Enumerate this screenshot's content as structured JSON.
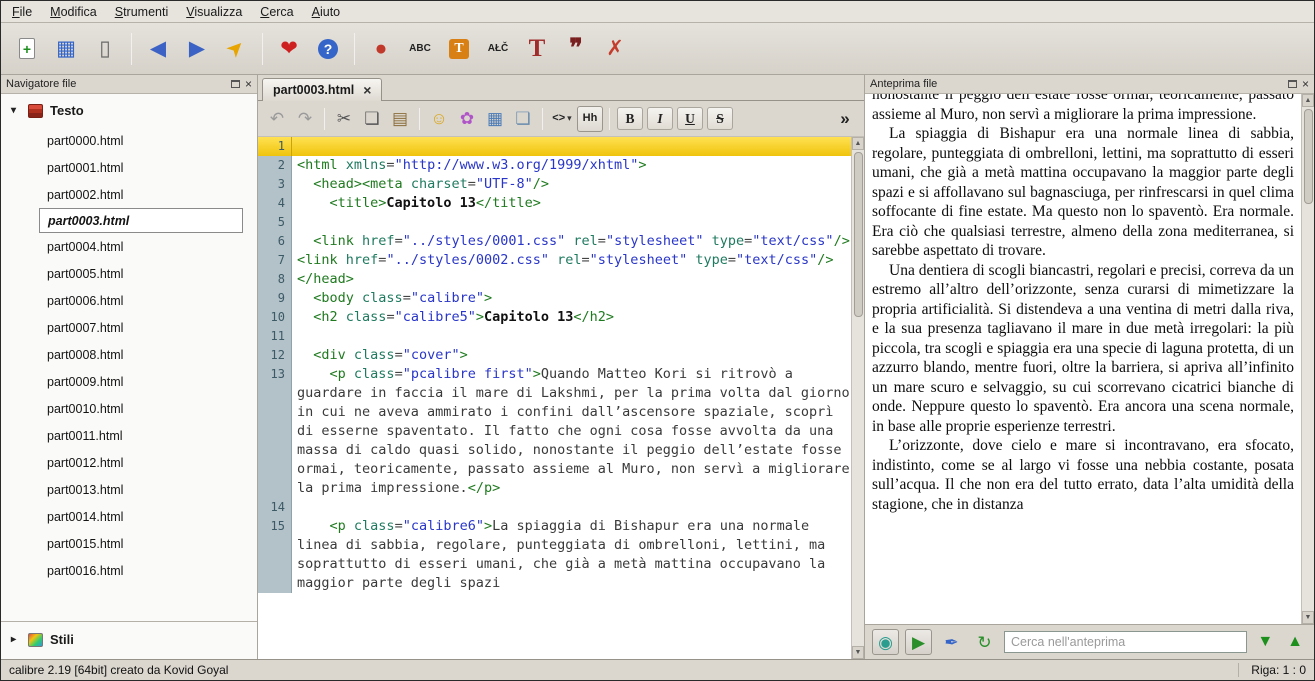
{
  "window": {
    "status_left": "calibre 2.19 [64bit] creato da Kovid Goyal",
    "status_right": "Riga: 1 : 0"
  },
  "menu": {
    "items": [
      "File",
      "Modifica",
      "Strumenti",
      "Visualizza",
      "Cerca",
      "Aiuto"
    ]
  },
  "main_toolbar": [
    {
      "name": "new-file-icon",
      "glyph": "+",
      "color": "#1e8f1e",
      "cls": "doc"
    },
    {
      "name": "save-icon",
      "glyph": "▦",
      "color": "#3565c8"
    },
    {
      "name": "send-to-device-icon",
      "glyph": "▯",
      "color": "#6a6a6a"
    },
    {
      "sep": true
    },
    {
      "name": "back-icon",
      "glyph": "◀",
      "color": "#3b62c4"
    },
    {
      "name": "forward-icon",
      "glyph": "▶",
      "color": "#3b62c4"
    },
    {
      "name": "goto-location-icon",
      "glyph": "➤",
      "color": "#e8a400",
      "cls": "rot-ne"
    },
    {
      "sep": true
    },
    {
      "name": "donate-icon",
      "glyph": "❤",
      "color": "#cf2020"
    },
    {
      "name": "help-icon",
      "glyph": "?",
      "color": "#ffffff",
      "cls": "circle-blue"
    },
    {
      "sep": true
    },
    {
      "name": "check-book-icon",
      "glyph": "●",
      "color": "#c0392b"
    },
    {
      "name": "spell-check-icon",
      "glyph": "ABC",
      "color": "#222222",
      "cls": "tiny-text"
    },
    {
      "name": "insert-special-char-icon",
      "glyph": "T",
      "color": "#ffffff",
      "cls": "box-orange"
    },
    {
      "name": "change-case-icon",
      "glyph": "AŁČ",
      "color": "#222222",
      "cls": "tiny-text"
    },
    {
      "name": "title-case-icon",
      "glyph": "T",
      "color": "#a02c2c",
      "cls": "serif-big"
    },
    {
      "name": "smart-quotes-icon",
      "glyph": "❞",
      "color": "#7a1f1f",
      "cls": "serif-big"
    },
    {
      "name": "fix-html-icon",
      "glyph": "✗",
      "color": "#c43c2c"
    }
  ],
  "file_navigator": {
    "title": "Navigatore file",
    "sections": {
      "text_label": "Testo",
      "styles_label": "Stili"
    },
    "files": [
      "part0000.html",
      "part0001.html",
      "part0002.html",
      "part0003.html",
      "part0004.html",
      "part0005.html",
      "part0006.html",
      "part0007.html",
      "part0008.html",
      "part0009.html",
      "part0010.html",
      "part0011.html",
      "part0012.html",
      "part0013.html",
      "part0014.html",
      "part0015.html",
      "part0016.html"
    ],
    "selected": "part0003.html"
  },
  "editor": {
    "tab_label": "part0003.html",
    "tab_close": "×",
    "toolbar": [
      {
        "name": "undo-icon",
        "glyph": "↶",
        "color": "#9a9a9a"
      },
      {
        "name": "redo-icon",
        "glyph": "↷",
        "color": "#9a9a9a"
      },
      {
        "sep": true
      },
      {
        "name": "cut-icon",
        "glyph": "✂",
        "color": "#555555"
      },
      {
        "name": "copy-icon",
        "glyph": "❏",
        "color": "#555555"
      },
      {
        "name": "paste-icon",
        "glyph": "▤",
        "color": "#8a6d3b"
      },
      {
        "sep": true
      },
      {
        "name": "arrange-file-icon",
        "glyph": "☺",
        "color": "#d9a514"
      },
      {
        "name": "special-character-icon",
        "glyph": "✿",
        "color": "#b055c8"
      },
      {
        "name": "insert-image-icon",
        "glyph": "▦",
        "color": "#4a7ab5"
      },
      {
        "name": "compare-icon",
        "glyph": "❏",
        "color": "#6a8caf"
      },
      {
        "sep": true
      },
      {
        "name": "insert-tag-icon",
        "glyph": "<>",
        "color": "#222222",
        "cls": "tiny-text",
        "caret": true
      },
      {
        "name": "insert-heading-icon",
        "glyph": "Hh",
        "color": "#222222",
        "cls": "boxed tiny-text"
      },
      {
        "sep": true
      },
      {
        "name": "bold-button",
        "glyph": "B",
        "color": "#222222",
        "cls": "fmt b"
      },
      {
        "name": "italic-button",
        "glyph": "I",
        "color": "#222222",
        "cls": "fmt i"
      },
      {
        "name": "underline-button",
        "glyph": "U",
        "color": "#222222",
        "cls": "fmt u"
      },
      {
        "name": "strike-button",
        "glyph": "S",
        "color": "#222222",
        "cls": "fmt s"
      },
      {
        "name": "toolbar-overflow-icon",
        "glyph": "»",
        "color": "#222222",
        "cls": "push-right"
      }
    ],
    "lines": [
      {
        "n": 1,
        "hl": true,
        "s": []
      },
      {
        "n": 2,
        "s": [
          [
            "t",
            "<html"
          ],
          [
            "p",
            " "
          ],
          [
            "a",
            "xmlns"
          ],
          [
            "p",
            "="
          ],
          [
            "v",
            "\"http://www.w3.org/1999/xhtml\""
          ],
          [
            "t",
            ">"
          ]
        ]
      },
      {
        "n": 3,
        "s": [
          [
            "p",
            "  "
          ],
          [
            "t",
            "<head>"
          ],
          [
            "t",
            "<meta"
          ],
          [
            "p",
            " "
          ],
          [
            "a",
            "charset"
          ],
          [
            "p",
            "="
          ],
          [
            "v",
            "\"UTF-8\""
          ],
          [
            "t",
            "/>"
          ]
        ]
      },
      {
        "n": 4,
        "s": [
          [
            "p",
            "    "
          ],
          [
            "t",
            "<title>"
          ],
          [
            "b",
            "Capitolo 13"
          ],
          [
            "t",
            "</title>"
          ]
        ]
      },
      {
        "n": 5,
        "s": []
      },
      {
        "n": 6,
        "s": [
          [
            "p",
            "  "
          ],
          [
            "t",
            "<link"
          ],
          [
            "p",
            " "
          ],
          [
            "a",
            "href"
          ],
          [
            "p",
            "="
          ],
          [
            "v",
            "\"../styles/0001.css\""
          ],
          [
            "p",
            " "
          ],
          [
            "a",
            "rel"
          ],
          [
            "p",
            "="
          ],
          [
            "v",
            "\"stylesheet\""
          ],
          [
            "p",
            " "
          ],
          [
            "a",
            "type"
          ],
          [
            "p",
            "="
          ],
          [
            "v",
            "\"text/css\""
          ],
          [
            "t",
            "/>"
          ]
        ]
      },
      {
        "n": 7,
        "s": [
          [
            "t",
            "<link"
          ],
          [
            "p",
            " "
          ],
          [
            "a",
            "href"
          ],
          [
            "p",
            "="
          ],
          [
            "v",
            "\"../styles/0002.css\""
          ],
          [
            "p",
            " "
          ],
          [
            "a",
            "rel"
          ],
          [
            "p",
            "="
          ],
          [
            "v",
            "\"stylesheet\""
          ],
          [
            "p",
            " "
          ],
          [
            "a",
            "type"
          ],
          [
            "p",
            "="
          ],
          [
            "v",
            "\"text/css\""
          ],
          [
            "t",
            "/>"
          ]
        ]
      },
      {
        "n": 8,
        "s": [
          [
            "t",
            "</head>"
          ]
        ]
      },
      {
        "n": 9,
        "s": [
          [
            "p",
            "  "
          ],
          [
            "t",
            "<body"
          ],
          [
            "p",
            " "
          ],
          [
            "a",
            "class"
          ],
          [
            "p",
            "="
          ],
          [
            "v",
            "\"calibre\""
          ],
          [
            "t",
            ">"
          ]
        ]
      },
      {
        "n": 10,
        "s": [
          [
            "p",
            "  "
          ],
          [
            "t",
            "<h2"
          ],
          [
            "p",
            " "
          ],
          [
            "a",
            "class"
          ],
          [
            "p",
            "="
          ],
          [
            "v",
            "\"calibre5\""
          ],
          [
            "t",
            ">"
          ],
          [
            "b",
            "Capitolo 13"
          ],
          [
            "t",
            "</h2>"
          ]
        ]
      },
      {
        "n": 11,
        "s": []
      },
      {
        "n": 12,
        "s": [
          [
            "p",
            "  "
          ],
          [
            "t",
            "<div"
          ],
          [
            "p",
            " "
          ],
          [
            "a",
            "class"
          ],
          [
            "p",
            "="
          ],
          [
            "v",
            "\"cover\""
          ],
          [
            "t",
            ">"
          ]
        ]
      },
      {
        "n": 13,
        "s": [
          [
            "p",
            "    "
          ],
          [
            "t",
            "<p"
          ],
          [
            "p",
            " "
          ],
          [
            "a",
            "class"
          ],
          [
            "p",
            "="
          ],
          [
            "v",
            "\"pcalibre first\""
          ],
          [
            "t",
            ">"
          ],
          [
            "x",
            "Quando Matteo Kori si ritrovò a guardare in faccia il mare di Lakshmi, per la prima volta dal giorno in cui ne aveva ammirato i confini dall’ascensore spaziale, scoprì di esserne spaventato. Il fatto che ogni cosa fosse avvolta da una massa di caldo quasi solido, nonostante il peggio dell’estate fosse ormai, teoricamente, passato assieme al Muro, non servì a migliorare la prima impressione."
          ],
          [
            "t",
            "</p>"
          ]
        ]
      },
      {
        "n": 14,
        "s": []
      },
      {
        "n": 15,
        "s": [
          [
            "p",
            "    "
          ],
          [
            "t",
            "<p"
          ],
          [
            "p",
            " "
          ],
          [
            "a",
            "class"
          ],
          [
            "p",
            "="
          ],
          [
            "v",
            "\"calibre6\""
          ],
          [
            "t",
            ">"
          ],
          [
            "x",
            "La spiaggia di Bishapur era una normale linea di sabbia, regolare, punteggiata di ombrelloni, lettini, ma soprattutto di esseri umani, che già a metà mattina occupavano la maggior parte degli spazi"
          ]
        ]
      }
    ]
  },
  "preview": {
    "title": "Anteprima file",
    "paragraphs": [
      "nonostante il peggio dell’estate fosse ormai, teoricamente, passato assieme al Muro, non servì a migliorare la prima impressione.",
      "La spiaggia di Bishapur era una normale linea di sabbia, regolare, punteggiata di ombrelloni, lettini, ma soprattutto di esseri umani, che già a metà mattina occupavano la maggior parte degli spazi e si affollavano sul bagnasciuga, per rinfrescarsi in quel clima soffocante di fine estate. Ma questo non lo spaventò. Era normale. Era ciò che qualsiasi terrestre, almeno della zona mediterranea, si sarebbe aspettato di trovare.",
      "Una dentiera di scogli biancastri, regolari e precisi, correva da un estremo all’altro dell’orizzonte, senza curarsi di mimetizzare la propria artificialità. Si distendeva a una ventina di metri dalla riva, e la sua presenza tagliavano il mare in due metà irregolari: la più piccola, tra scogli e spiaggia era una specie di laguna protetta, di un azzurro blando, mentre fuori, oltre la barriera, si apriva all’infinito un mare scuro e selvaggio, su cui scorrevano cicatrici bianche di onde. Neppure questo lo spaventò. Era ancora una scena normale, in base alle proprie esperienze terrestri.",
      "L’orizzonte, dove cielo e mare si incontravano, era sfocato, indistinto, come se al largo vi fosse una nebbia costante, posata sull’acqua. Il che non era del tutto errato, data l’alta umidità della stagione, che in distanza"
    ],
    "toolbar": [
      {
        "name": "live-preview-icon",
        "glyph": "◉",
        "color": "#2a9d8f",
        "cls": "btn-raised"
      },
      {
        "name": "play-icon",
        "glyph": "▶",
        "color": "#2a8f2a",
        "cls": "btn-raised"
      },
      {
        "name": "follow-cursor-icon",
        "glyph": "✒",
        "color": "#3565c8"
      },
      {
        "name": "refresh-icon",
        "glyph": "↻",
        "color": "#2a8f2a"
      }
    ],
    "search_placeholder": "Cerca nell'anteprima",
    "next_glyph": "▼",
    "prev_glyph": "▲"
  },
  "tree_glyphs": {
    "expanded": "▾",
    "collapsed": "▸"
  },
  "scroll_glyphs": {
    "up": "▲",
    "down": "▼"
  }
}
